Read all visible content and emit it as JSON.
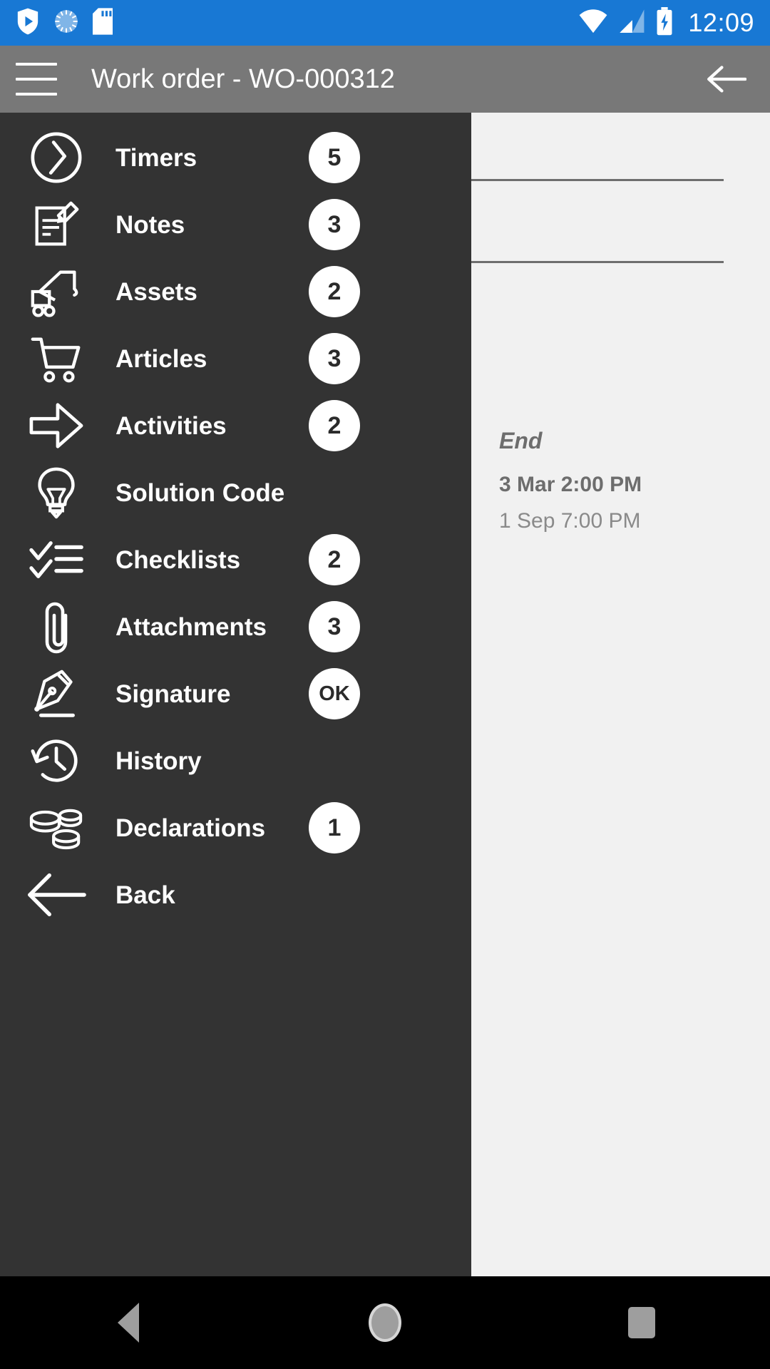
{
  "status_bar": {
    "background_color": "#1878d4",
    "time": "12:09",
    "icons": [
      "shield-play-icon",
      "sync-spinner-icon",
      "sd-card-icon"
    ],
    "right_icons": [
      "wifi-icon",
      "cell-signal-icon",
      "battery-charging-icon"
    ]
  },
  "app_bar": {
    "background_color": "#787878",
    "title": "Work order - WO-000312",
    "menu_icon": "hamburger-icon",
    "back_icon": "arrow-left-icon"
  },
  "drawer": {
    "background_color": "#333333",
    "badge_background": "#ffffff",
    "badge_text_color": "#2b2b2b",
    "items": [
      {
        "label": "Timers",
        "icon": "clock-icon",
        "badge": "5"
      },
      {
        "label": "Notes",
        "icon": "note-edit-icon",
        "badge": "3"
      },
      {
        "label": "Assets",
        "icon": "crane-icon",
        "badge": "2"
      },
      {
        "label": "Articles",
        "icon": "shopping-cart-icon",
        "badge": "3"
      },
      {
        "label": "Activities",
        "icon": "arrow-right-block-icon",
        "badge": "2"
      },
      {
        "label": "Solution Code",
        "icon": "lightbulb-icon",
        "badge": ""
      },
      {
        "label": "Checklists",
        "icon": "checklist-icon",
        "badge": "2"
      },
      {
        "label": "Attachments",
        "icon": "paperclip-icon",
        "badge": "3"
      },
      {
        "label": "Signature",
        "icon": "fountain-pen-icon",
        "badge": "OK"
      },
      {
        "label": "History",
        "icon": "history-icon",
        "badge": ""
      },
      {
        "label": "Declarations",
        "icon": "coins-icon",
        "badge": "1"
      },
      {
        "label": "Back",
        "icon": "arrow-left-long-icon",
        "badge": ""
      }
    ]
  },
  "page": {
    "background_color": "#f1f1f1",
    "end_section": {
      "label": "End",
      "date_primary": "3 Mar 2:00 PM",
      "date_secondary": "1 Sep 7:00 PM"
    }
  },
  "nav_bar": {
    "background_color": "#000000",
    "buttons": [
      {
        "name": "back",
        "icon": "nav-back-triangle-icon"
      },
      {
        "name": "home",
        "icon": "nav-home-circle-icon"
      },
      {
        "name": "recents",
        "icon": "nav-recents-square-icon"
      }
    ]
  }
}
